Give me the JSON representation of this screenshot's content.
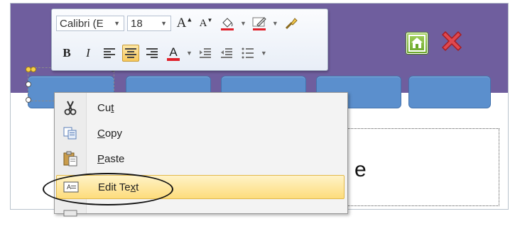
{
  "toolbar": {
    "font_name": "Calibri (E",
    "font_size": "18",
    "bold_label": "B",
    "italic_label": "I",
    "font_color": "#e0202a",
    "highlight_color": "#e0202a",
    "line_color": "#e0202a"
  },
  "header": {
    "background_color": "#6f5e9e",
    "home_icon": "home-icon",
    "close_icon": "close-icon"
  },
  "nav_buttons_color": "#5b8fcd",
  "slide": {
    "partial_text": "e"
  },
  "context_menu": {
    "items": [
      {
        "label_pre": "Cu",
        "label_acc": "t",
        "label_post": "",
        "icon": "scissors-icon"
      },
      {
        "label_pre": "",
        "label_acc": "C",
        "label_post": "opy",
        "icon": "copy-icon"
      },
      {
        "label_pre": "",
        "label_acc": "P",
        "label_post": "aste",
        "icon": "paste-icon"
      },
      {
        "label_pre": "Edit Te",
        "label_acc": "x",
        "label_post": "t",
        "icon": "edit-text-icon",
        "highlighted": true
      }
    ]
  }
}
